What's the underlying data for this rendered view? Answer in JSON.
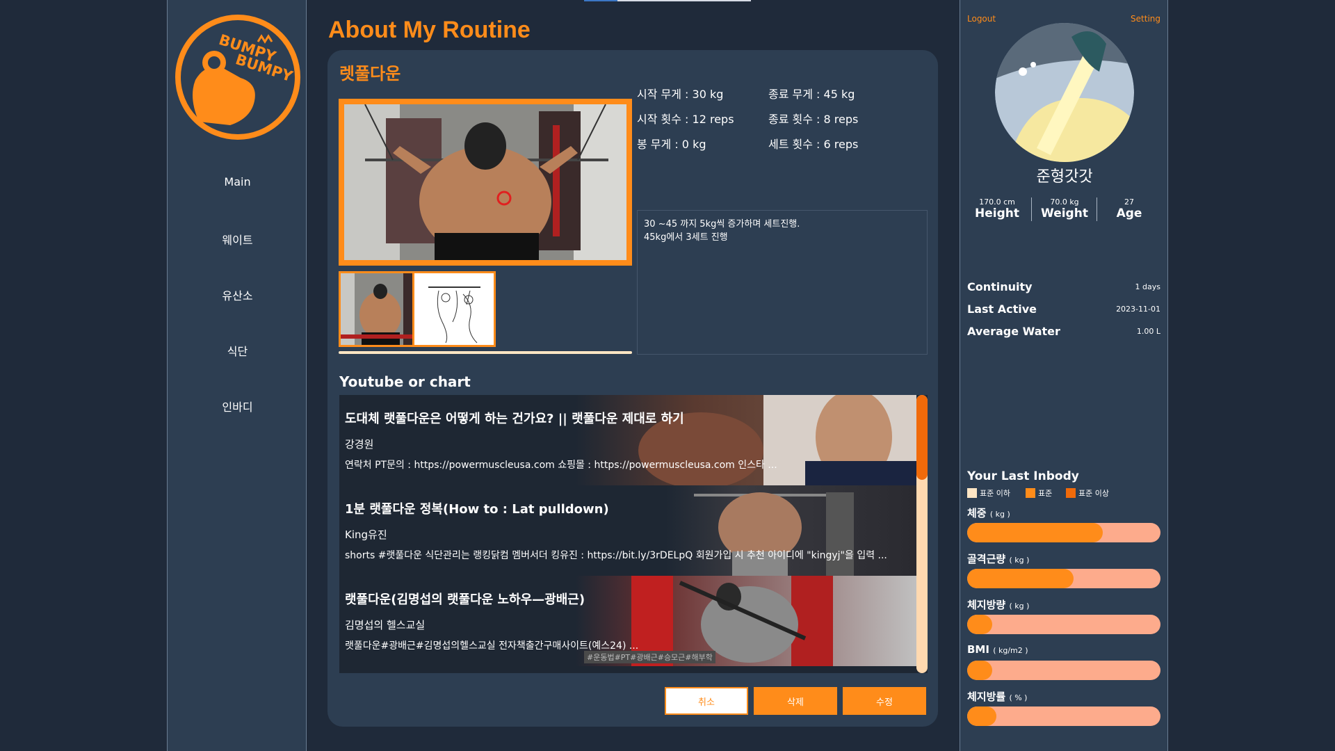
{
  "logo": {
    "line1": "BUMPY",
    "line2": "BUMPY"
  },
  "nav": [
    "Main",
    "웨이트",
    "유산소",
    "식단",
    "인바디"
  ],
  "page_title": "About My Routine",
  "exercise": {
    "name": "렛풀다운",
    "start_weight": "시작 무게 : 30 kg",
    "end_weight": "종료 무게 : 45 kg",
    "start_reps": "시작 횟수 : 12 reps",
    "end_reps": "종료 횟수 : 8 reps",
    "bar_weight": "봉 무게 : 0 kg",
    "set_count": "세트 횟수 : 6 reps",
    "memo_line1": "30 ~45 까지 5kg씩 증가하며 세트진행.",
    "memo_line2": "45kg에서 3세트 진행"
  },
  "youtube_section_title": "Youtube or chart",
  "videos": [
    {
      "title": "도대체 랫풀다운은 어떻게 하는 건가요? || 랫풀다운 제대로 하기",
      "channel": "강경원",
      "desc": "연락처 PT문의 : https://powermuscleusa.com 쇼핑몰 : https://powermuscleusa.com 인스타 ..."
    },
    {
      "title": "1분 랫풀다운 정복(How to : Lat pulldown)",
      "channel": "King유진",
      "desc": "shorts #랫풀다운 식단관리는 랭킹닭컴 멤버서더 킹유진 : https://bit.ly/3rDELpQ 회원가입 시 추천 아이디에 \"kingyj\"을 입력 ..."
    },
    {
      "title": "랫풀다운(김명섭의 랫풀다운 노하우—광배근)",
      "channel": "김명섭의 헬스교실",
      "desc": "랫풀다운#광배근#김명섭의헬스교실 전자책출간구매사이트(예스24) ...",
      "overlay": "#운동법#PT#광배근#승모근#해부학"
    }
  ],
  "buttons": {
    "cancel": "취소",
    "delete": "삭제",
    "edit": "수정"
  },
  "profile": {
    "logout": "Logout",
    "setting": "Setting",
    "username": "준형갓갓",
    "height_value": "170.0 cm",
    "height_label": "Height",
    "weight_value": "70.0 kg",
    "weight_label": "Weight",
    "age_value": "27",
    "age_label": "Age",
    "continuity_label": "Continuity",
    "continuity_value": "1 days",
    "last_active_label": "Last Active",
    "last_active_value": "2023-11-01",
    "water_label": "Average Water",
    "water_value": "1.00 L"
  },
  "inbody": {
    "title": "Your Last Inbody",
    "legend": [
      "표준 이하",
      "표준",
      "표준 이상"
    ],
    "legend_colors": [
      "#ffe6c4",
      "#ff8c1a",
      "#f06a0a"
    ],
    "bars": [
      {
        "label": "체중",
        "unit": "( kg )",
        "fill": 0.7
      },
      {
        "label": "골격근량",
        "unit": "( kg )",
        "fill": 0.55
      },
      {
        "label": "체지방량",
        "unit": "( kg )",
        "fill": 0.13
      },
      {
        "label": "BMI",
        "unit": "( kg/m2 )",
        "fill": 0.13
      },
      {
        "label": "체지방률",
        "unit": "( % )",
        "fill": 0.15
      }
    ]
  },
  "colors": {
    "accent": "#ff8c1a",
    "background": "#1f2a3a",
    "panel": "#2d3e52"
  }
}
